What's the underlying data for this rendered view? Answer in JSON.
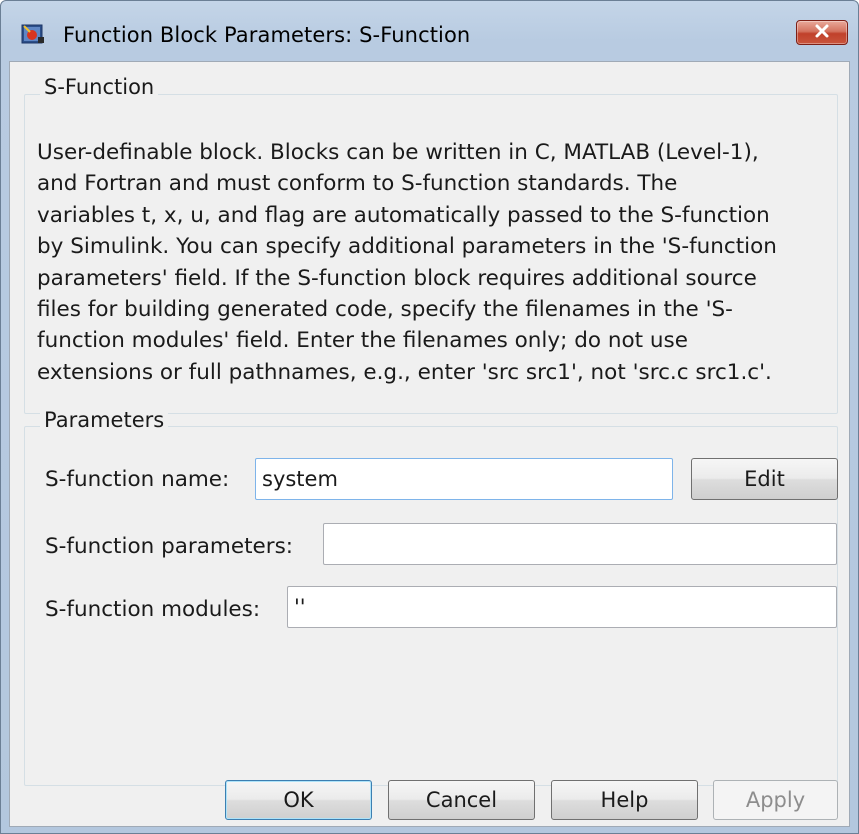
{
  "window": {
    "title": "Function Block Parameters: S-Function",
    "icon": "simulink-block-icon",
    "close_icon": "close-icon"
  },
  "description_group": {
    "title": "S-Function",
    "text": "User-definable block.  Blocks can be written in C, MATLAB (Level-1),\nand Fortran and must conform to S-function standards.  The\nvariables t, x, u, and flag are automatically passed to the S-function\nby Simulink.  You can specify additional parameters in the 'S-function\nparameters' field. If the S-function block requires additional source\nfiles for building generated code, specify the filenames in the 'S-\nfunction modules' field. Enter the filenames only; do not use\nextensions or full pathnames, e.g., enter 'src src1', not 'src.c src1.c'."
  },
  "parameters_group": {
    "title": "Parameters",
    "name_label": "S-function name:",
    "name_value": "system",
    "edit_label": "Edit",
    "params_label": "S-function parameters:",
    "params_value": "",
    "modules_label": "S-function modules:",
    "modules_value": "''"
  },
  "buttons": {
    "ok": "OK",
    "cancel": "Cancel",
    "help": "Help",
    "apply": "Apply"
  },
  "colors": {
    "title_bar": "#b8cbe1",
    "panel": "#f0f0f0",
    "close_button": "#c9553c",
    "default_button_border": "#3c7fb1"
  }
}
